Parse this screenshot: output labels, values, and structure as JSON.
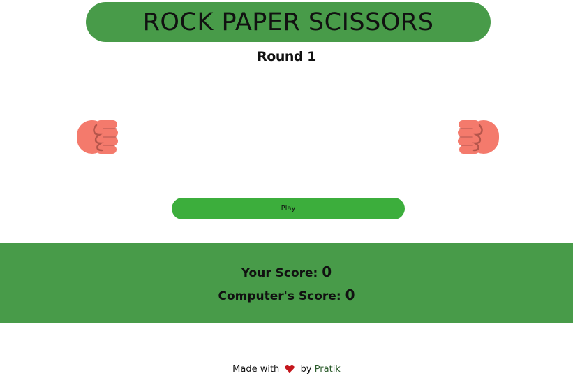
{
  "header": {
    "title": "ROCK PAPER SCISSORS"
  },
  "round": {
    "label": "Round 1"
  },
  "hands": {
    "player_icon": "rock-fist-icon",
    "computer_icon": "rock-fist-icon",
    "color": "#f47a6c"
  },
  "controls": {
    "play_label": "Play"
  },
  "scores": {
    "your_label": "Your Score:",
    "your_value": "0",
    "computer_label": "Computer's Score:",
    "computer_value": "0"
  },
  "footer": {
    "made_with": "Made with",
    "by": "by",
    "author": "Pratik",
    "heart_icon": "heart-icon"
  },
  "colors": {
    "banner": "#489b49",
    "button": "#3cae3c",
    "heart": "#c4161c"
  }
}
